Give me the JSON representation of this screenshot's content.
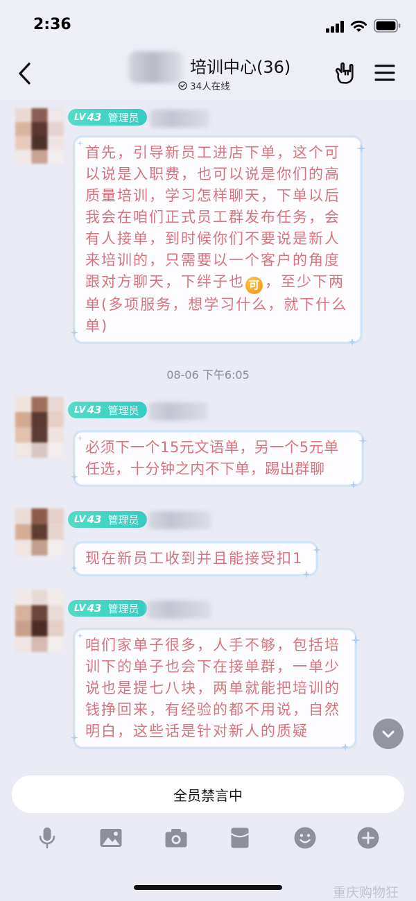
{
  "status_bar": {
    "time": "2:36",
    "icons": [
      "cellular-signal-icon",
      "wifi-icon",
      "battery-icon"
    ]
  },
  "header": {
    "back_icon": "chevron-left-icon",
    "title": "培训中心(36)",
    "online_icon": "online-status-icon",
    "online_text": "34人在线",
    "right_icons": [
      "hand-gesture-icon",
      "menu-icon"
    ]
  },
  "messages": [
    {
      "badge": {
        "lv": "LV",
        "level": "43",
        "role": "管理员"
      },
      "lines": [
        "首先，引导新员工进店下单，这个可",
        "以说是入职费，也可以说是你们的高",
        "质量培训，学习怎样聊天，下单以后",
        "我会在咱们正式员工群发布任务，会",
        "有人接单，到时候你们不要说是新人",
        "来培训的，只需要以一个客户的角度",
        {
          "before": "跟对方聊天，下绊子也",
          "emoji": "可",
          "after": "，至少下两"
        },
        "单(多项服务，想学习什么，就下什么",
        "单)"
      ]
    },
    {
      "badge": {
        "lv": "LV",
        "level": "43",
        "role": "管理员"
      },
      "lines": [
        "必须下一个15元文语单，另一个5元单",
        "任选，十分钟之内不下单，踢出群聊"
      ]
    },
    {
      "badge": {
        "lv": "LV",
        "level": "43",
        "role": "管理员"
      },
      "lines": [
        "现在新员工收到并且能接受扣1"
      ]
    },
    {
      "badge": {
        "lv": "LV",
        "level": "43",
        "role": "管理员"
      },
      "lines": [
        "咱们家单子很多，人手不够，包括培",
        "训下的单子也会下在接单群，一单少",
        "说也是提七八块，两单就能把培训的",
        "钱挣回来，有经验的都不用说，自然",
        "明白，这些话是针对新人的质疑"
      ]
    }
  ],
  "timestamps": [
    "08-06 下午6:05"
  ],
  "scroll_button": {
    "icon": "chevron-down-icon"
  },
  "composer": {
    "muted_text": "全员禁言中"
  },
  "toolbar": {
    "icons": [
      "microphone-icon",
      "image-icon",
      "camera-icon",
      "red-packet-icon",
      "emoji-icon",
      "plus-icon"
    ]
  },
  "watermark": {
    "text": "重庆购物狂"
  },
  "colors": {
    "background": "#eaebf4",
    "badge": "#3fd2ba",
    "bubble_text": "#d8737d",
    "bubble_border": "#d3e3f6",
    "icon_gray": "#8e8f9a",
    "emoji_orange": "#ec9510"
  }
}
